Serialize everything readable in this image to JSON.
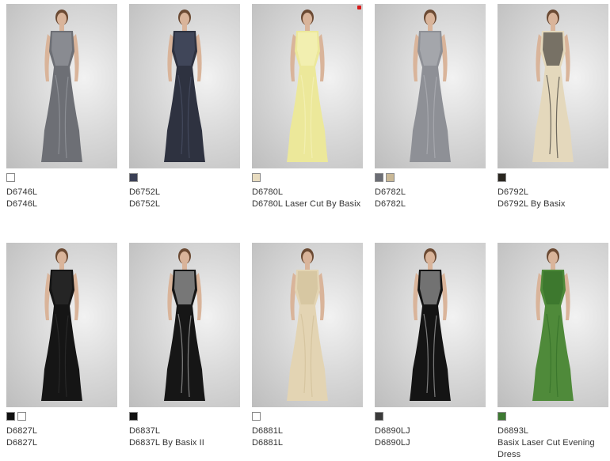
{
  "products": [
    {
      "code": "D6746L",
      "name": "D6746L",
      "dress": "#6d6f75",
      "accent": "#a0a3a8",
      "swatches": [
        "#ffffff"
      ]
    },
    {
      "code": "D6752L",
      "name": "D6752L",
      "dress": "#2e3240",
      "accent": "#50576e",
      "swatches": [
        "#3a3f55"
      ]
    },
    {
      "code": "D6780L",
      "name": "D6780L Laser Cut By Basix",
      "dress": "#ece89a",
      "accent": "#f7f4c2",
      "swatches": [
        "#e8dcc0"
      ]
    },
    {
      "code": "D6782L",
      "name": "D6782L",
      "dress": "#8e9096",
      "accent": "#b6b8bd",
      "swatches": [
        "#6b6d74",
        "#c9b896"
      ]
    },
    {
      "code": "D6792L",
      "name": "D6792L By Basix",
      "dress": "#e4d8bc",
      "accent": "#1e1e1e",
      "swatches": [
        "#2a2620"
      ]
    },
    {
      "code": "D6827L",
      "name": "D6827L",
      "dress": "#151515",
      "accent": "#333333",
      "swatches": [
        "#111111",
        "#ffffff"
      ]
    },
    {
      "code": "D6837L",
      "name": "D6837L By Basix II",
      "dress": "#161616",
      "accent": "#c9c9c9",
      "swatches": [
        "#111111"
      ]
    },
    {
      "code": "D6881L",
      "name": "D6881L",
      "dress": "#e3d4b3",
      "accent": "#cdbb93",
      "swatches": [
        "#ffffff"
      ]
    },
    {
      "code": "D6890LJ",
      "name": "D6890LJ",
      "dress": "#141414",
      "accent": "#bfbfbf",
      "swatches": [
        "#3a3a3a"
      ]
    },
    {
      "code": "D6893L",
      "name": "Basix Laser Cut Evening Dress",
      "dress": "#4f8a3a",
      "accent": "#2f6a25",
      "swatches": [
        "#3d7a32"
      ]
    }
  ]
}
